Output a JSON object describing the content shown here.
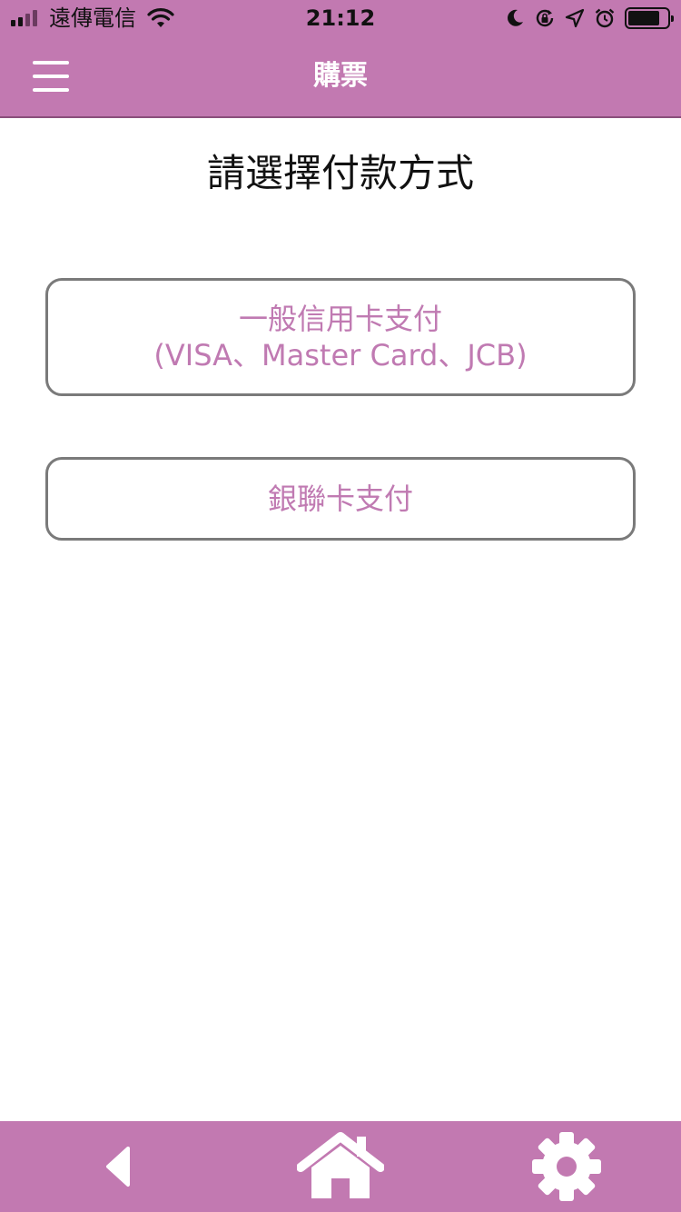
{
  "status_bar": {
    "carrier": "遠傳電信",
    "time": "21:12"
  },
  "nav": {
    "title": "購票"
  },
  "main": {
    "title": "請選擇付款方式",
    "buttons": [
      {
        "line1": "一般信用卡支付",
        "line2": "(VISA、Master Card、JCB)"
      },
      {
        "line1": "銀聯卡支付"
      }
    ]
  },
  "toolbar": {
    "icons": [
      "back-icon",
      "home-icon",
      "settings-icon"
    ]
  },
  "colors": {
    "brand": "#c279b1",
    "button_text": "#c07ab2",
    "button_border": "#7a7a7a"
  }
}
